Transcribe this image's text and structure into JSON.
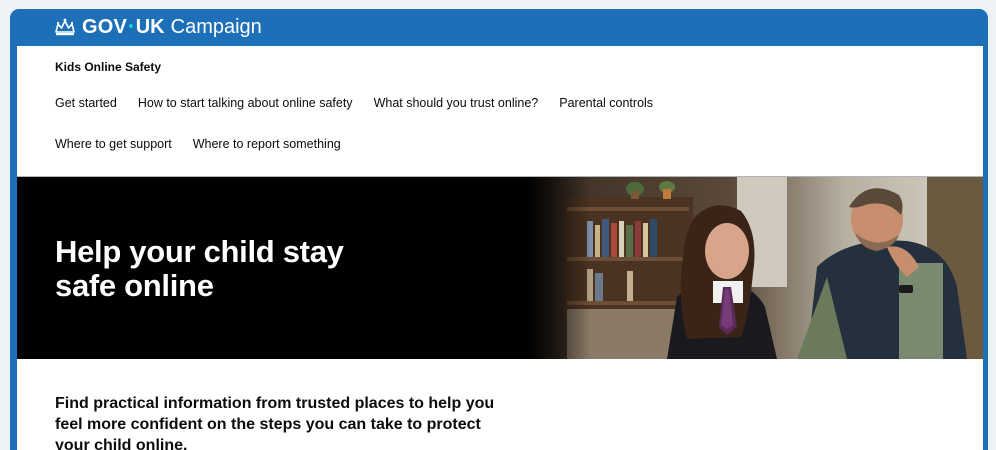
{
  "header": {
    "brand_gov": "GOV",
    "brand_sep": "·",
    "brand_uk": "UK",
    "brand_campaign": "Campaign",
    "crown_icon": "crown-icon"
  },
  "site": {
    "title": "Kids Online Safety"
  },
  "nav": {
    "row1": [
      "Get started",
      "How to start talking about online safety",
      "What should you trust online?",
      "Parental controls"
    ],
    "row2": [
      "Where to get support",
      "Where to report something"
    ]
  },
  "hero": {
    "title": "Help your child stay safe online"
  },
  "intro": {
    "text": "Find practical information from trusted places to help you feel more confident on the steps you can take to protect your child online."
  },
  "colors": {
    "brand_blue": "#1d70b8",
    "hero_bg": "#000000",
    "text": "#0b0c0c"
  }
}
